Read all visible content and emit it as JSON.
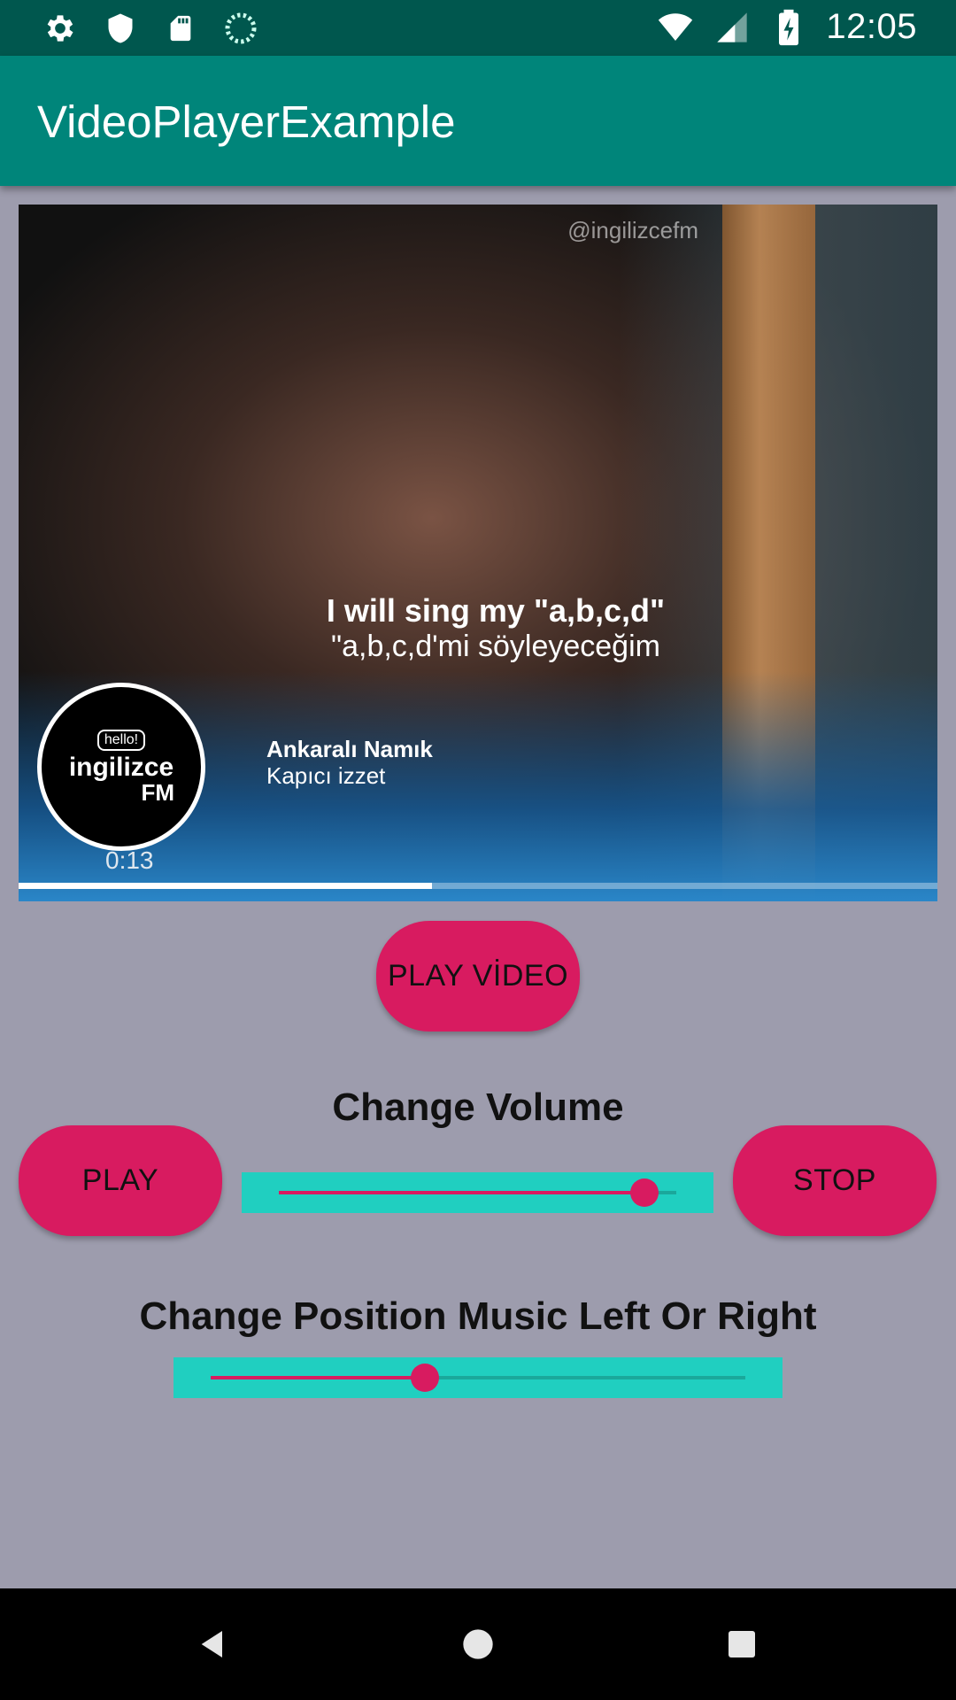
{
  "status_bar": {
    "time": "12:05",
    "icons_left": [
      "gear-icon",
      "shield-icon",
      "sd-card-icon",
      "sync-icon"
    ],
    "icons_right": [
      "wifi-icon",
      "signal-icon",
      "battery-charging-icon"
    ]
  },
  "app_bar": {
    "title": "VideoPlayerExample"
  },
  "video": {
    "watermark": "@ingilizcefm",
    "subtitle_en": "I will sing my \"a,b,c,d\"",
    "subtitle_tr": "\"a,b,c,d'mi söyleyeceğim",
    "logo": {
      "bubble": "hello!",
      "main": "ingilizce",
      "sub": "FM"
    },
    "credit_name": "Ankaralı Namık",
    "credit_role": "Kapıcı izzet",
    "current_time": "0:13",
    "progress_fraction": 0.45
  },
  "buttons": {
    "play_video": "PLAY VİDEO",
    "play": "PLAY",
    "stop": "STOP"
  },
  "volume": {
    "label": "Change Volume",
    "value_fraction": 0.92
  },
  "balance": {
    "label": "Change Position Music Left Or Right",
    "value_fraction": 0.4
  },
  "colors": {
    "status_bar": "#00574e",
    "app_bar": "#00857a",
    "accent": "#d81b60",
    "slider_bg": "#20cfc0",
    "background": "#9d9cad"
  }
}
